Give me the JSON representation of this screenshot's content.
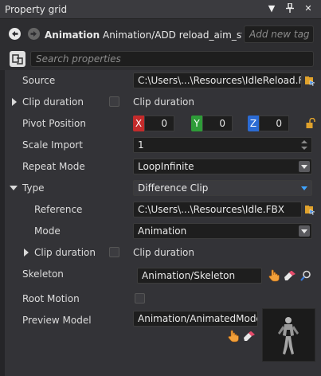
{
  "panel": {
    "title": "Property grid"
  },
  "header": {
    "asset_type": "Animation",
    "asset_path": "Animation/ADD reload_aim_stan...",
    "tag_placeholder": "Add new tag"
  },
  "search": {
    "placeholder": "Search properties"
  },
  "colors": {
    "x_axis": "#c42b2b",
    "y_axis": "#2e9c38",
    "z_axis": "#2b6bd4",
    "accent_blue": "#3fa4ff"
  },
  "properties": {
    "source": {
      "label": "Source",
      "value": "C:\\Users\\...\\Resources\\IdleReload.FBX"
    },
    "clip_duration": {
      "label": "Clip duration",
      "checkbox_label": "Clip duration"
    },
    "pivot_position": {
      "label": "Pivot Position",
      "x_label": "X",
      "x": "0",
      "y_label": "Y",
      "y": "0",
      "z_label": "Z",
      "z": "0"
    },
    "scale_import": {
      "label": "Scale Import",
      "value": "1"
    },
    "repeat_mode": {
      "label": "Repeat Mode",
      "value": "LoopInfinite"
    },
    "type": {
      "label": "Type",
      "value": "Difference Clip"
    },
    "reference": {
      "label": "Reference",
      "value": "C:\\Users\\...\\Resources\\Idle.FBX"
    },
    "mode": {
      "label": "Mode",
      "value": "Animation"
    },
    "sub_clip_duration": {
      "label": "Clip duration",
      "checkbox_label": "Clip duration"
    },
    "skeleton": {
      "label": "Skeleton",
      "value": "Animation/Skeleton"
    },
    "root_motion": {
      "label": "Root Motion"
    },
    "preview_model": {
      "label": "Preview Model",
      "value": "Animation/AnimatedModel"
    }
  }
}
